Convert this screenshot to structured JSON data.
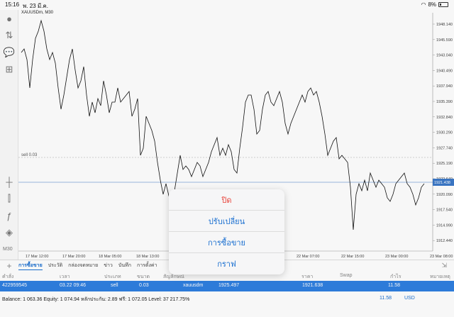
{
  "status_bar": {
    "time": "15:16",
    "date": "พ. 23 มี.ค.",
    "battery": "8%"
  },
  "sidebar": {
    "timeframe": "M30"
  },
  "chart": {
    "symbol_label": "XAUUSDm, M30",
    "sell_label": "sell 0.03",
    "price_labels": [
      "1948.140",
      "1945.590",
      "1943.040",
      "1940.490",
      "1937.940",
      "1935.390",
      "1932.840",
      "1930.290",
      "1927.740",
      "1925.190",
      "1922.640",
      "1920.090",
      "1917.540",
      "1914.990",
      "1912.440"
    ],
    "current_price": "1921.438",
    "time_labels": [
      "17 Mar 12:00",
      "17 Mar 20:00",
      "18 Mar 05:00",
      "18 Mar 13:00",
      "22 Mar 23:00",
      "22 Mar 07:00",
      "22 Mar 15:00",
      "23 Mar 00:00",
      "23 Mar 08:00"
    ],
    "colors": {
      "line": "#111111",
      "current_price_bg": "#3b78c8",
      "sell_line": "#aaaaaa",
      "grid": "#e8e8e8"
    }
  },
  "bottom_tabs": [
    "การซื้อขาย",
    "ประวัติ",
    "กล่องจดหมาย",
    "ข่าว",
    "บันทึก",
    "การตั้งค่า"
  ],
  "table": {
    "headers": {
      "symbol": "คำสั่ง",
      "time": "เวลา",
      "type": "ประเภท",
      "volume": "ขนาด",
      "name": "สัญลักษณ์",
      "swap": "Swap",
      "profit": "กำไร",
      "comment": "หมายเหตุ",
      "price": "ราคา"
    },
    "row": {
      "ticket": "422959545",
      "time": "03.22 09:46",
      "type": "sell",
      "volume": "0.03",
      "symbol": "xauusdm",
      "open_price": "1925.497",
      "price": "1921.638",
      "profit": "11.58"
    }
  },
  "footer": {
    "balance_text": "Balance: 1 063.36 Equity: 1 074.94 หลักประกัน: 2.89 ฟรี: 1 072.05 Level: 37 217.75%",
    "profit": "11.58",
    "currency": "USD"
  },
  "popover": {
    "items": [
      "ปิด",
      "ปรับเปลี่ยน",
      "การซื้อขาย",
      "กราฟ"
    ]
  }
}
